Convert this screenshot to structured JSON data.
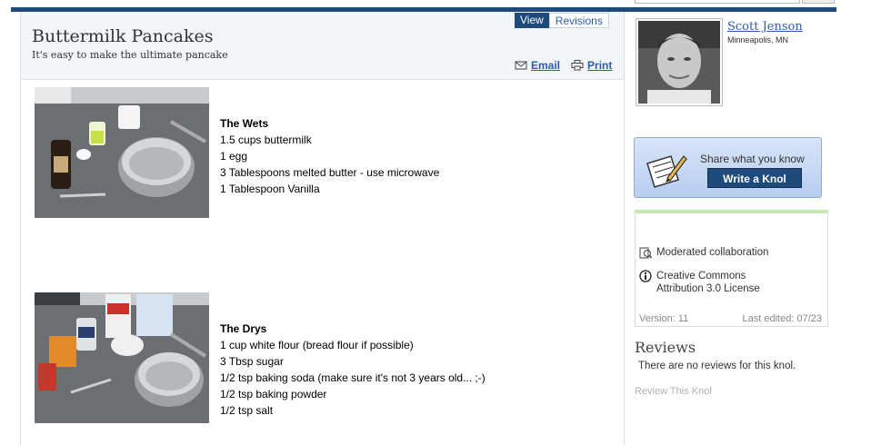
{
  "knol": {
    "title": "Buttermilk Pancakes",
    "subtitle": "It's easy to make the ultimate pancake"
  },
  "tabs": [
    {
      "label": "View",
      "active": true
    },
    {
      "label": "Revisions",
      "active": false
    }
  ],
  "actions": {
    "email_label": "Email",
    "print_label": "Print"
  },
  "sections": [
    {
      "heading": "The Wets",
      "lines": [
        "1.5 cups buttermilk",
        "1 egg",
        "3 Tablespoons melted butter - use microwave",
        "1 Tablespoon Vanilla"
      ]
    },
    {
      "heading": "The Drys",
      "lines": [
        "1 cup white flour (bread flour if possible)",
        "3 Tbsp sugar",
        "1/2 tsp baking soda (make sure it's not 3  years old... ;-)",
        "1/2 tsp baking powder",
        "1/2 tsp salt"
      ]
    }
  ],
  "author": {
    "name": "Scott Jenson",
    "location": "Minneapolis, MN"
  },
  "share": {
    "prompt": "Share what you know",
    "button_label": "Write a Knol"
  },
  "info": {
    "collaboration": "Moderated collaboration",
    "license_line1": "Creative Commons",
    "license_line2": "Attribution 3.0 License",
    "version": "Version: 11",
    "last_edited": "Last edited: 07/23"
  },
  "reviews": {
    "title": "Reviews",
    "empty_text": "There are no reviews for this knol.",
    "link_label": "Review This Knol"
  },
  "icons": {
    "email": "envelope-icon",
    "print": "printer-icon",
    "share": "pencil-paper-icon",
    "collaboration": "moderated-collaboration-icon",
    "license": "creative-commons-icon"
  },
  "colors": {
    "accent": "#1e4a7c",
    "link": "#2a5db0",
    "header_bg": "#f2f5fa"
  }
}
